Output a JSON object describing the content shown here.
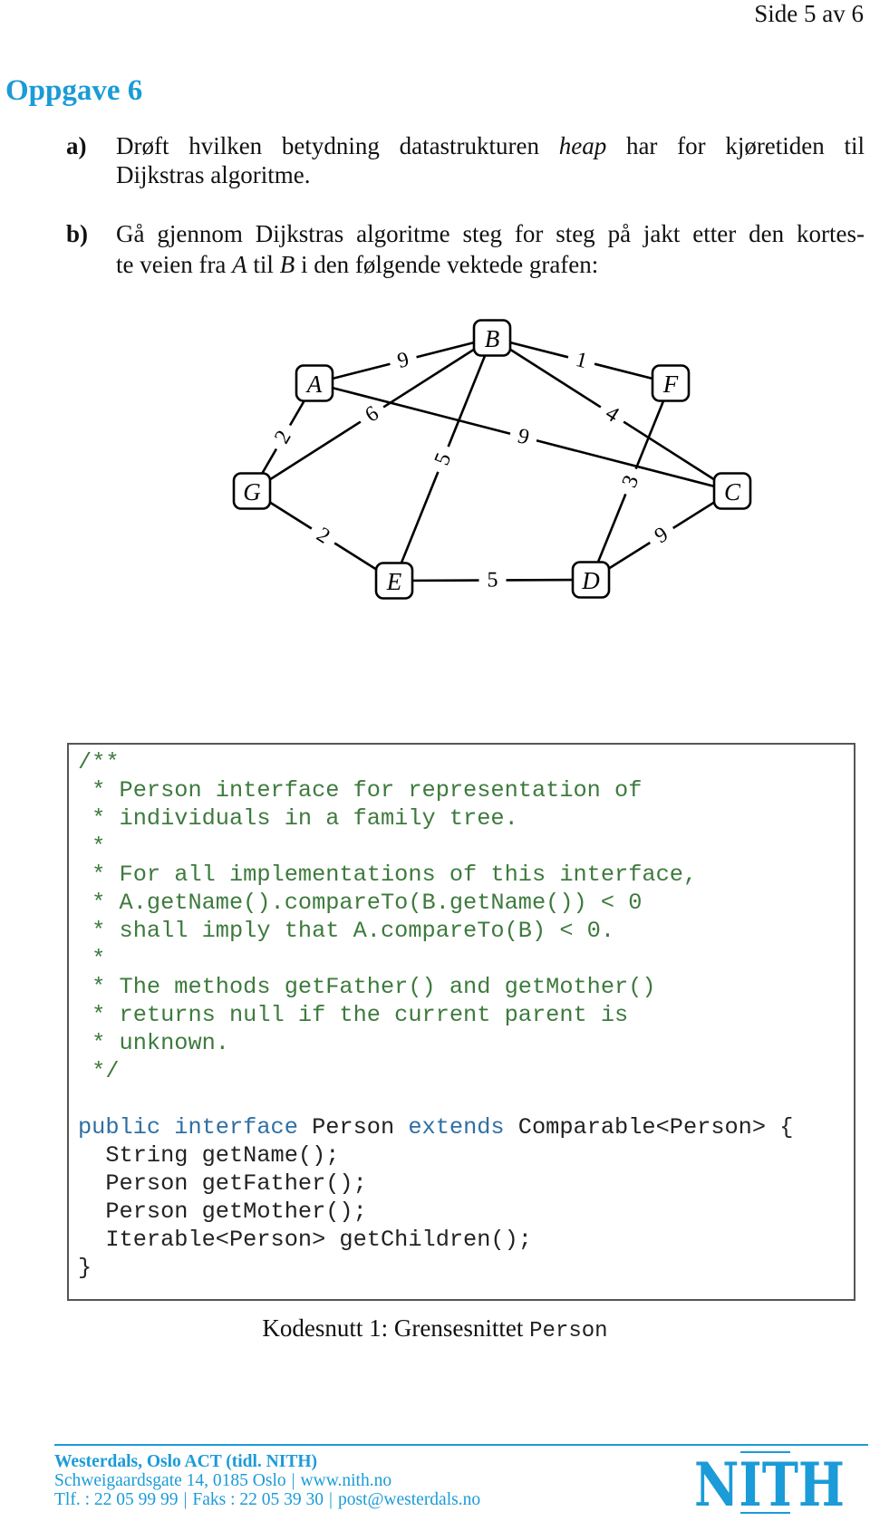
{
  "header": {
    "page_indicator": "Side 5 av 6"
  },
  "task": {
    "title": "Oppgave 6",
    "questions": [
      {
        "label": "a)",
        "line1_before": "Drøft hvilken betydning datastrukturen ",
        "line1_emph": "heap",
        "line1_after": " har for kjøretiden til",
        "line2": "Dijkstras algoritme."
      },
      {
        "label": "b)",
        "line1": "Gå gjennom Dijkstras algoritme steg for steg på jakt etter den kortes-",
        "line2_before": "te veien fra ",
        "line2_from": "A",
        "line2_mid": " til ",
        "line2_to": "B",
        "line2_after": " i den følgende vektede grafen:"
      }
    ]
  },
  "graph": {
    "nodes": [
      {
        "id": "A",
        "label": "A"
      },
      {
        "id": "B",
        "label": "B"
      },
      {
        "id": "C",
        "label": "C"
      },
      {
        "id": "D",
        "label": "D"
      },
      {
        "id": "E",
        "label": "E"
      },
      {
        "id": "F",
        "label": "F"
      },
      {
        "id": "G",
        "label": "G"
      }
    ],
    "edges": [
      {
        "from": "A",
        "to": "B",
        "weight": "9"
      },
      {
        "from": "A",
        "to": "G",
        "weight": "2"
      },
      {
        "from": "A",
        "to": "C",
        "weight": "9"
      },
      {
        "from": "G",
        "to": "B",
        "weight": "6"
      },
      {
        "from": "B",
        "to": "E",
        "weight": "5"
      },
      {
        "from": "B",
        "to": "F",
        "weight": "1"
      },
      {
        "from": "B",
        "to": "C",
        "weight": "4"
      },
      {
        "from": "F",
        "to": "D",
        "weight": "3"
      },
      {
        "from": "G",
        "to": "E",
        "weight": "2"
      },
      {
        "from": "E",
        "to": "D",
        "weight": "5"
      },
      {
        "from": "D",
        "to": "C",
        "weight": "9"
      }
    ]
  },
  "code_snippet": {
    "lines": [
      [
        {
          "t": "/**",
          "c": "comment"
        }
      ],
      [
        {
          "t": " * Person interface for representation of",
          "c": "comment"
        }
      ],
      [
        {
          "t": " * individuals in a family tree.",
          "c": "comment"
        }
      ],
      [
        {
          "t": " *",
          "c": "comment"
        }
      ],
      [
        {
          "t": " * For all implementations of this interface,",
          "c": "comment"
        }
      ],
      [
        {
          "t": " * A.getName().compareTo(B.getName()) < 0",
          "c": "comment"
        }
      ],
      [
        {
          "t": " * shall imply that A.compareTo(B) < 0.",
          "c": "comment"
        }
      ],
      [
        {
          "t": " *",
          "c": "comment"
        }
      ],
      [
        {
          "t": " * The methods getFather() and getMother()",
          "c": "comment"
        }
      ],
      [
        {
          "t": " * returns null if the current parent is",
          "c": "comment"
        }
      ],
      [
        {
          "t": " * unknown.",
          "c": "comment"
        }
      ],
      [
        {
          "t": " */",
          "c": "comment"
        }
      ],
      [
        {
          "t": "",
          "c": "plain"
        }
      ],
      [
        {
          "t": "public interface",
          "c": "keyword"
        },
        {
          "t": " Person ",
          "c": "plain"
        },
        {
          "t": "extends",
          "c": "keyword"
        },
        {
          "t": " Comparable<Person> {",
          "c": "plain"
        }
      ],
      [
        {
          "t": "  String getName();",
          "c": "plain"
        }
      ],
      [
        {
          "t": "  Person getFather();",
          "c": "plain"
        }
      ],
      [
        {
          "t": "  Person getMother();",
          "c": "plain"
        }
      ],
      [
        {
          "t": "  Iterable<Person> getChildren();",
          "c": "plain"
        }
      ],
      [
        {
          "t": "}",
          "c": "plain"
        }
      ]
    ],
    "caption_prefix": "Kodesnutt 1: Grensesnittet ",
    "caption_code": "Person"
  },
  "footer": {
    "organization": "Westerdals, Oslo ACT (tidl. NITH)",
    "address": "Schweigaardsgate 14, 0185 Oslo",
    "website": "www.nith.no",
    "phone": "Tlf. : 22 05 99 99",
    "fax": "Faks : 22 05 39 30",
    "email": "post@westerdals.no",
    "separator": "|",
    "logo_text": "NITH"
  },
  "colors": {
    "accent": "#1b9bd7",
    "code_comment": "#3d7a3d",
    "code_keyword": "#2f6fa3",
    "code_plain": "#222222"
  }
}
